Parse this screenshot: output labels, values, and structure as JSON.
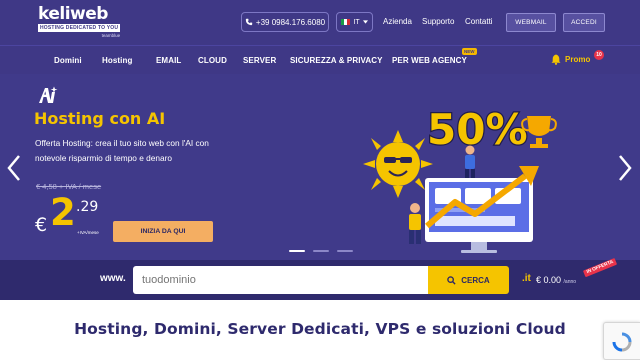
{
  "header": {
    "logo_text": "keliweb",
    "logo_tagline": "HOSTING DEDICATED TO YOU",
    "logo_sub": "teamblue",
    "phone": "+39 0984.176.6080",
    "language": "IT",
    "links": [
      "Azienda",
      "Supporto",
      "Contatti"
    ],
    "webmail_label": "WEBMAIL",
    "login_label": "ACCEDI"
  },
  "nav": {
    "items": [
      "Domini",
      "Hosting",
      "EMAIL",
      "CLOUD",
      "SERVER",
      "SICUREZZA & PRIVACY",
      "PER WEB AGENCY"
    ],
    "new_badge": "NEW",
    "promo_label": "Promo",
    "promo_count": "10"
  },
  "hero": {
    "title": "Hosting con AI",
    "description": "Offerta Hosting: crea il tuo sito web con l'AI con notevole risparmio di tempo e denaro",
    "old_price": "€ 4,58 + IVA / mese",
    "currency": "€",
    "price_int": "2",
    "price_dec": ".29",
    "price_unit": "+IVA/mese",
    "cta_label": "INIZIA DA QUI",
    "promo_percent": "50%",
    "slide_count": 3,
    "active_slide": 0
  },
  "search": {
    "prefix": "www.",
    "placeholder": "tuodominio",
    "button_label": "CERCA",
    "tld": ".it",
    "tld_price": "€ 0.00",
    "tld_unit": "/anno",
    "offer_badge": "IN OFFERTA"
  },
  "tagline": "Hosting, Domini, Server Dedicati, VPS e soluzioni Cloud",
  "colors": {
    "primary": "#3f3886",
    "accent": "#f5c400",
    "cta": "#f4ae62",
    "badge_red": "#e8334a"
  },
  "icons": [
    "phone-icon",
    "flag-icon",
    "chevron-down-icon",
    "bell-icon",
    "ai-icon",
    "chevron-left-icon",
    "chevron-right-icon",
    "search-icon",
    "recaptcha-icon"
  ]
}
